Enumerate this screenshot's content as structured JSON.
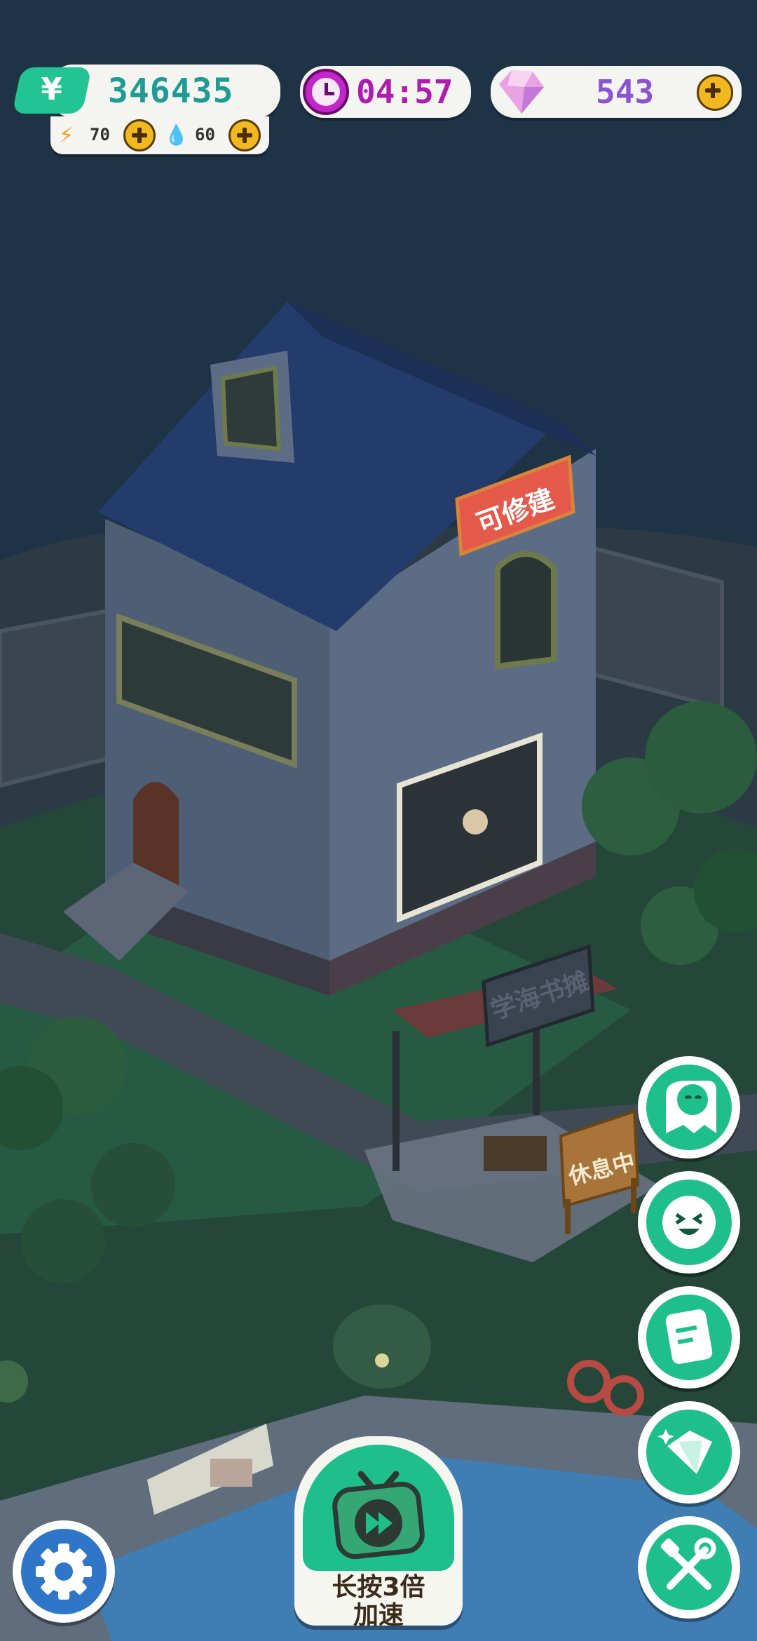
{
  "hud": {
    "money": "346435",
    "energy": "70",
    "water": "60",
    "timer": "04:57",
    "gems": "543"
  },
  "scene": {
    "house_sign": "可修建",
    "stall_sign": "学海书摊",
    "rest_sign": "休息中"
  },
  "speed_button": {
    "line1": "长按3倍",
    "line2": "加速"
  },
  "side_buttons": [
    {
      "icon": "ghost-face-icon"
    },
    {
      "icon": "laughing-face-icon"
    },
    {
      "icon": "notepad-icon"
    },
    {
      "icon": "diamond-sparkle-icon"
    },
    {
      "icon": "tools-icon"
    }
  ],
  "colors": {
    "sky": "#1f3347",
    "accent_green": "#1fbf8c",
    "sign_red": "#e5594a",
    "gem_purple": "#8a54d0",
    "timer_magenta": "#b01bb0"
  }
}
